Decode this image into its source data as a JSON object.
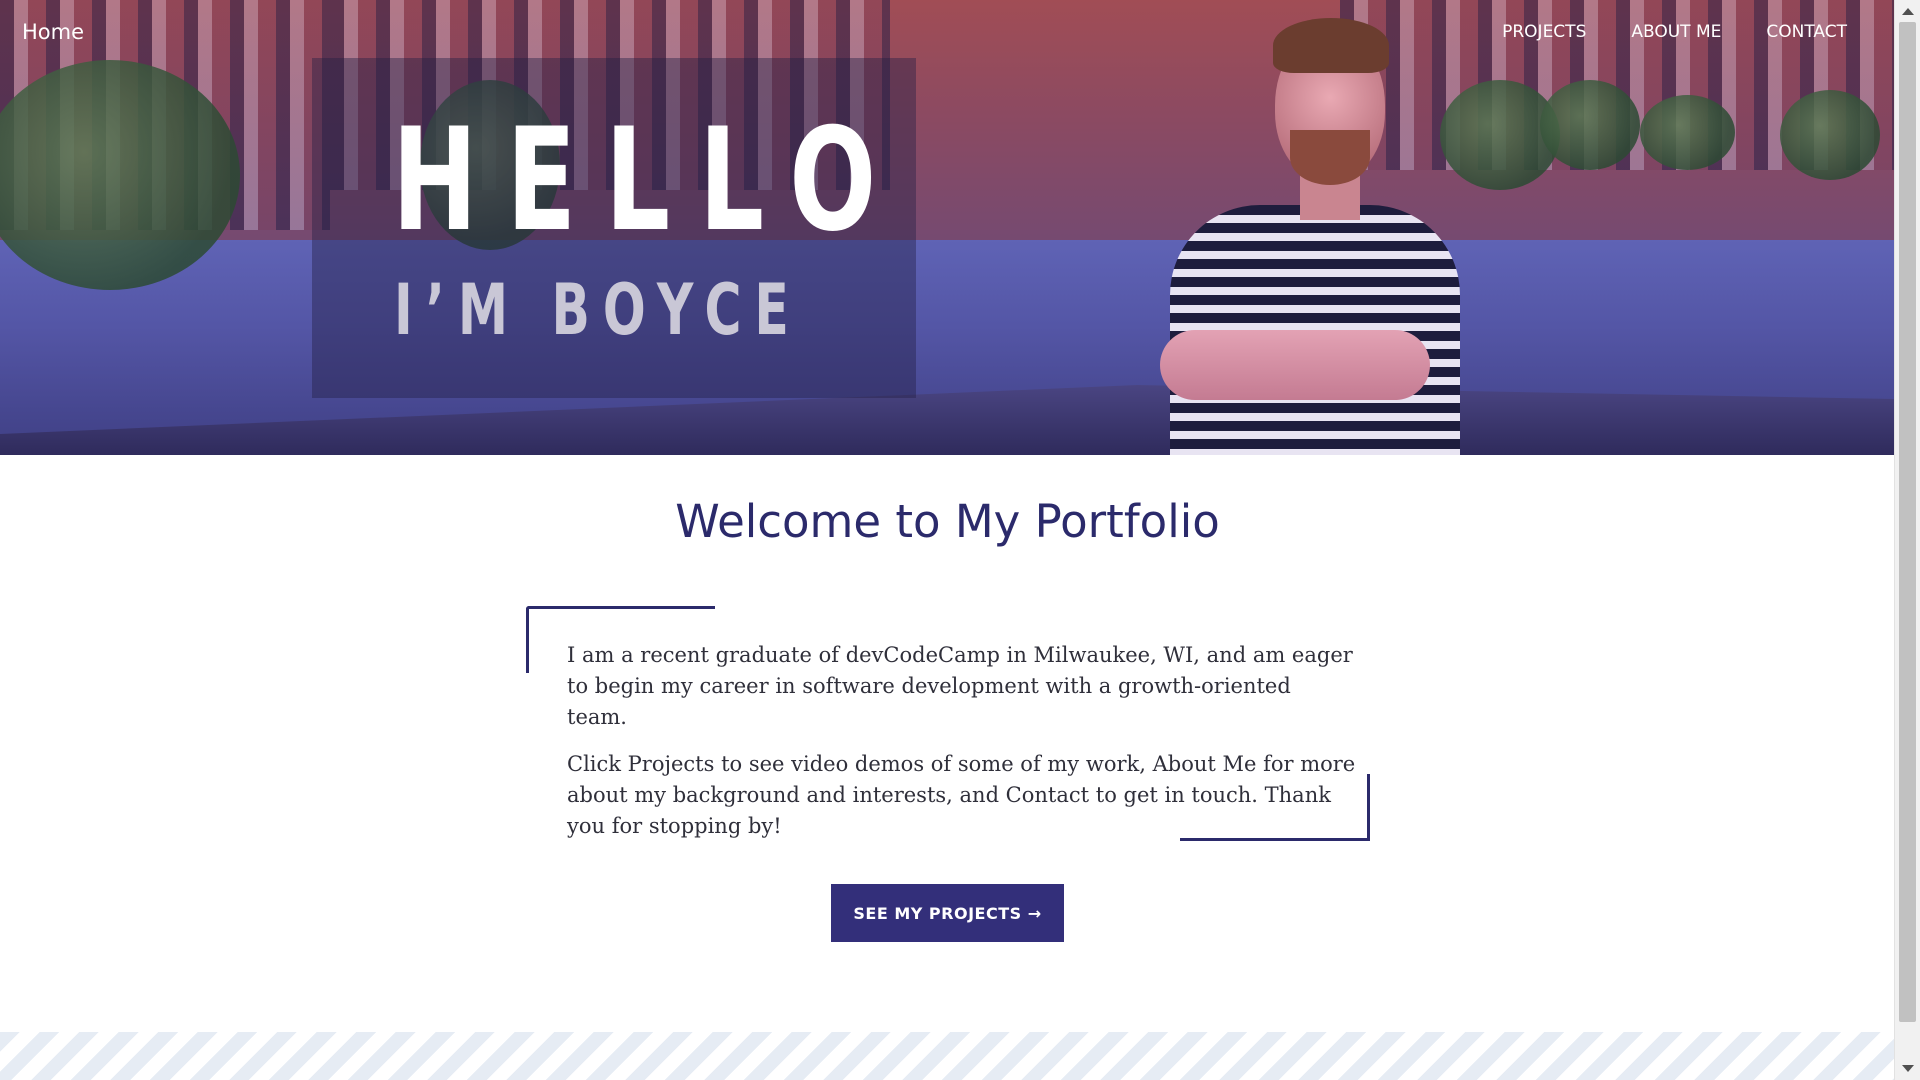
{
  "nav": {
    "home_label": "Home",
    "links": [
      "PROJECTS",
      "ABOUT ME",
      "CONTACT"
    ]
  },
  "hero": {
    "headline": "HELLO",
    "subheadline": "I’M BOYCE"
  },
  "main": {
    "title": "Welcome to My Portfolio",
    "paragraphs": [
      "I am a recent graduate of devCodeCamp in Milwaukee, WI, and am eager to begin my career in software development with a growth-oriented team.",
      "Click Projects to see video demos of some of my work, About Me for more about my background and interests, and Contact to get in touch. Thank you for stopping by!"
    ],
    "cta_label": "SEE MY PROJECTS →"
  },
  "colors": {
    "accent": "#332f7a",
    "title": "#2b2a6b",
    "body_text": "#2f2f3a"
  }
}
